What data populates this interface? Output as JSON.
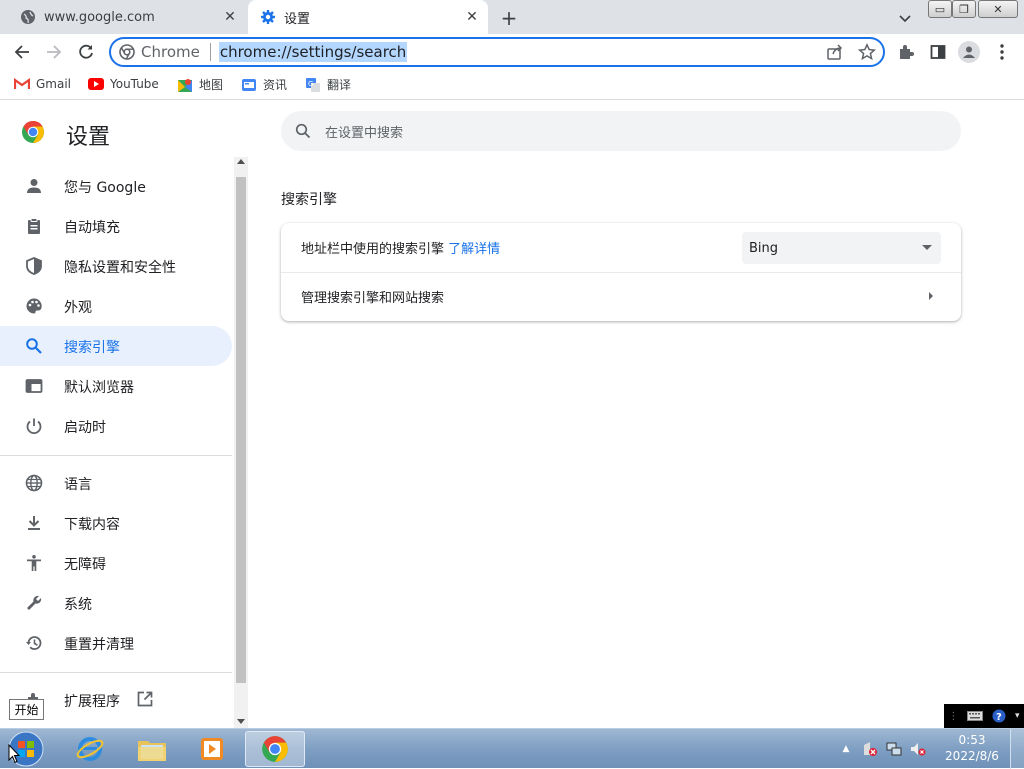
{
  "tabs": [
    {
      "title": "www.google.com",
      "icon": "globe-icon",
      "active": false
    },
    {
      "title": "设置",
      "icon": "settings-gear-icon",
      "active": true
    }
  ],
  "toolbar": {
    "omnibox_chip": "Chrome",
    "url": "chrome://settings/search"
  },
  "bookmarks": [
    {
      "label": "Gmail",
      "icon": "gmail-icon"
    },
    {
      "label": "YouTube",
      "icon": "youtube-icon"
    },
    {
      "label": "地图",
      "icon": "maps-icon"
    },
    {
      "label": "资讯",
      "icon": "news-icon"
    },
    {
      "label": "翻译",
      "icon": "translate-icon"
    }
  ],
  "settings": {
    "title": "设置",
    "search_placeholder": "在设置中搜索",
    "nav": [
      {
        "label": "您与 Google",
        "icon": "person-icon"
      },
      {
        "label": "自动填充",
        "icon": "clipboard-icon"
      },
      {
        "label": "隐私设置和安全性",
        "icon": "shield-icon"
      },
      {
        "label": "外观",
        "icon": "palette-icon"
      },
      {
        "label": "搜索引擎",
        "icon": "search-icon",
        "active": true
      },
      {
        "label": "默认浏览器",
        "icon": "browser-window-icon"
      },
      {
        "label": "启动时",
        "icon": "power-icon"
      },
      {
        "label": "语言",
        "icon": "globe-icon"
      },
      {
        "label": "下载内容",
        "icon": "download-icon"
      },
      {
        "label": "无障碍",
        "icon": "accessibility-icon"
      },
      {
        "label": "系统",
        "icon": "wrench-icon"
      },
      {
        "label": "重置并清理",
        "icon": "history-icon"
      },
      {
        "label": "扩展程序",
        "icon": "puzzle-icon"
      }
    ],
    "section_title": "搜索引擎",
    "row1_label": "地址栏中使用的搜索引擎",
    "row1_link": "了解详情",
    "engine_selected": "Bing",
    "row2_label": "管理搜索引擎和网站搜索"
  },
  "tooltip": "开始",
  "taskbar": {
    "time": "0:53",
    "date": "2022/8/6"
  },
  "colors": {
    "accent": "#1a73e8",
    "active_bg": "#e8f0fe"
  }
}
